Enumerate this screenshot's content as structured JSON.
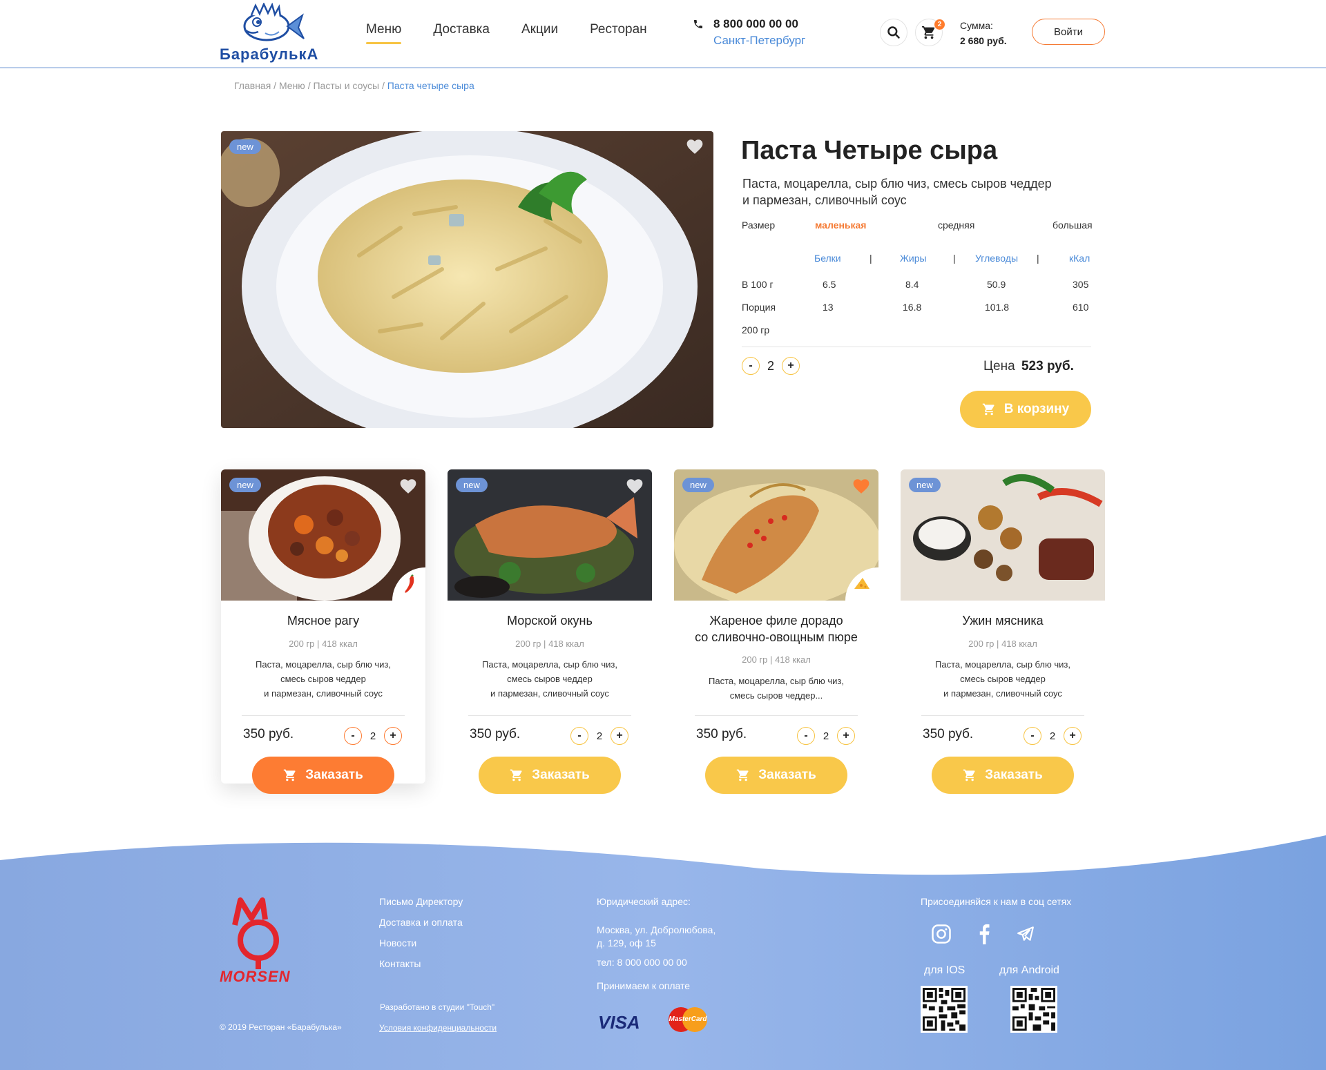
{
  "header": {
    "logo_text": "БарабулькА",
    "nav": [
      {
        "label": "Меню",
        "active": true
      },
      {
        "label": "Доставка",
        "active": false
      },
      {
        "label": "Акции",
        "active": false
      },
      {
        "label": "Ресторан",
        "active": false
      }
    ],
    "phone": "8 800 000 00 00",
    "city": "Санкт-Петербург",
    "cart_count": "2",
    "sum_label": "Сумма:",
    "sum_value": "2 680 руб.",
    "login_label": "Войти"
  },
  "breadcrumb": {
    "items": [
      "Главная /",
      "Меню /",
      "Пасты и соусы /"
    ],
    "current": "Паста четыре сыра"
  },
  "product": {
    "badge": "new",
    "title": "Паста Четыре сыра",
    "description": "Паста, моцарелла, сыр блю чиз, смесь сыров чеддер и пармезан, сливочный соус",
    "size_label": "Размер",
    "sizes": [
      "маленькая",
      "средняя",
      "большая"
    ],
    "selected_size": "маленькая",
    "nutrition_headers": [
      "Белки",
      "Жиры",
      "Углеводы",
      "кКал"
    ],
    "nutrition_sep": "|",
    "rows": [
      {
        "label": "В 100 г",
        "values": [
          "6.5",
          "8.4",
          "50.9",
          "305"
        ]
      },
      {
        "label": "Порция",
        "values": [
          "13",
          "16.8",
          "101.8",
          "610"
        ]
      }
    ],
    "portion_weight": "200 гр",
    "qty_minus": "-",
    "qty_plus": "+",
    "qty": "2",
    "price_label": "Цена",
    "price_value": "523 руб.",
    "cart_button": "В корзину"
  },
  "cards": [
    {
      "badge": "new",
      "title": "Мясное рагу",
      "weight": "200 гр",
      "kcal": "418 ккал",
      "description_lines": [
        "Паста, моцарелла, сыр блю чиз,",
        "смесь сыров чеддер",
        "и пармезан, сливочный соус"
      ],
      "price": "350 руб.",
      "qty": "2",
      "order_label": "Заказать"
    },
    {
      "badge": "new",
      "title": "Морской окунь",
      "weight": "200 гр",
      "kcal": "418 ккал",
      "description_lines": [
        "Паста, моцарелла, сыр блю чиз,",
        "смесь сыров чеддер",
        "и пармезан, сливочный соус"
      ],
      "price": "350 руб.",
      "qty": "2",
      "order_label": "Заказать"
    },
    {
      "badge": "new",
      "title_lines": [
        "Жареное филе дорадо",
        "со сливочно-овощным пюре"
      ],
      "weight": "200 гр",
      "kcal": "418 ккал",
      "description_lines": [
        "Паста, моцарелла, сыр блю чиз,",
        "смесь сыров чеддер..."
      ],
      "price": "350 руб.",
      "qty": "2",
      "order_label": "Заказать"
    },
    {
      "badge": "new",
      "title": "Ужин мясника",
      "weight": "200 гр",
      "kcal": "418 ккал",
      "description_lines": [
        "Паста, моцарелла, сыр блю чиз,",
        "смесь сыров чеддер",
        "и пармезан, сливочный соус"
      ],
      "price": "350 руб.",
      "qty": "2",
      "order_label": "Заказать"
    }
  ],
  "meta_sep": "|",
  "footer": {
    "brand_logo": "MORSEN",
    "copyright": "© 2019 Ресторан «Барабулька»",
    "links": [
      "Письмо Директору",
      "Доставка и оплата",
      "Новости",
      "Контакты"
    ],
    "studio": "Разработано в студии \"Touch\"",
    "privacy": "Условия конфиденциальности",
    "address_heading": "Юридический адрес:",
    "address_lines": [
      "Москва, ул. Добролюбова,",
      "д. 129, оф 15"
    ],
    "phone": "тел: 8 000 000 00 00",
    "payment_heading": "Принимаем к оплате",
    "visa": "VISA",
    "mastercard": "MasterCard",
    "social_heading": "Присоединяйся к нам в соц сетях",
    "ios_label": "для IOS",
    "android_label": "для Android"
  },
  "colors": {
    "accent_yellow": "#f9c84a",
    "accent_orange": "#fd7c33",
    "link_blue": "#4a8ad8",
    "footer_blue": "#8aaee6"
  }
}
